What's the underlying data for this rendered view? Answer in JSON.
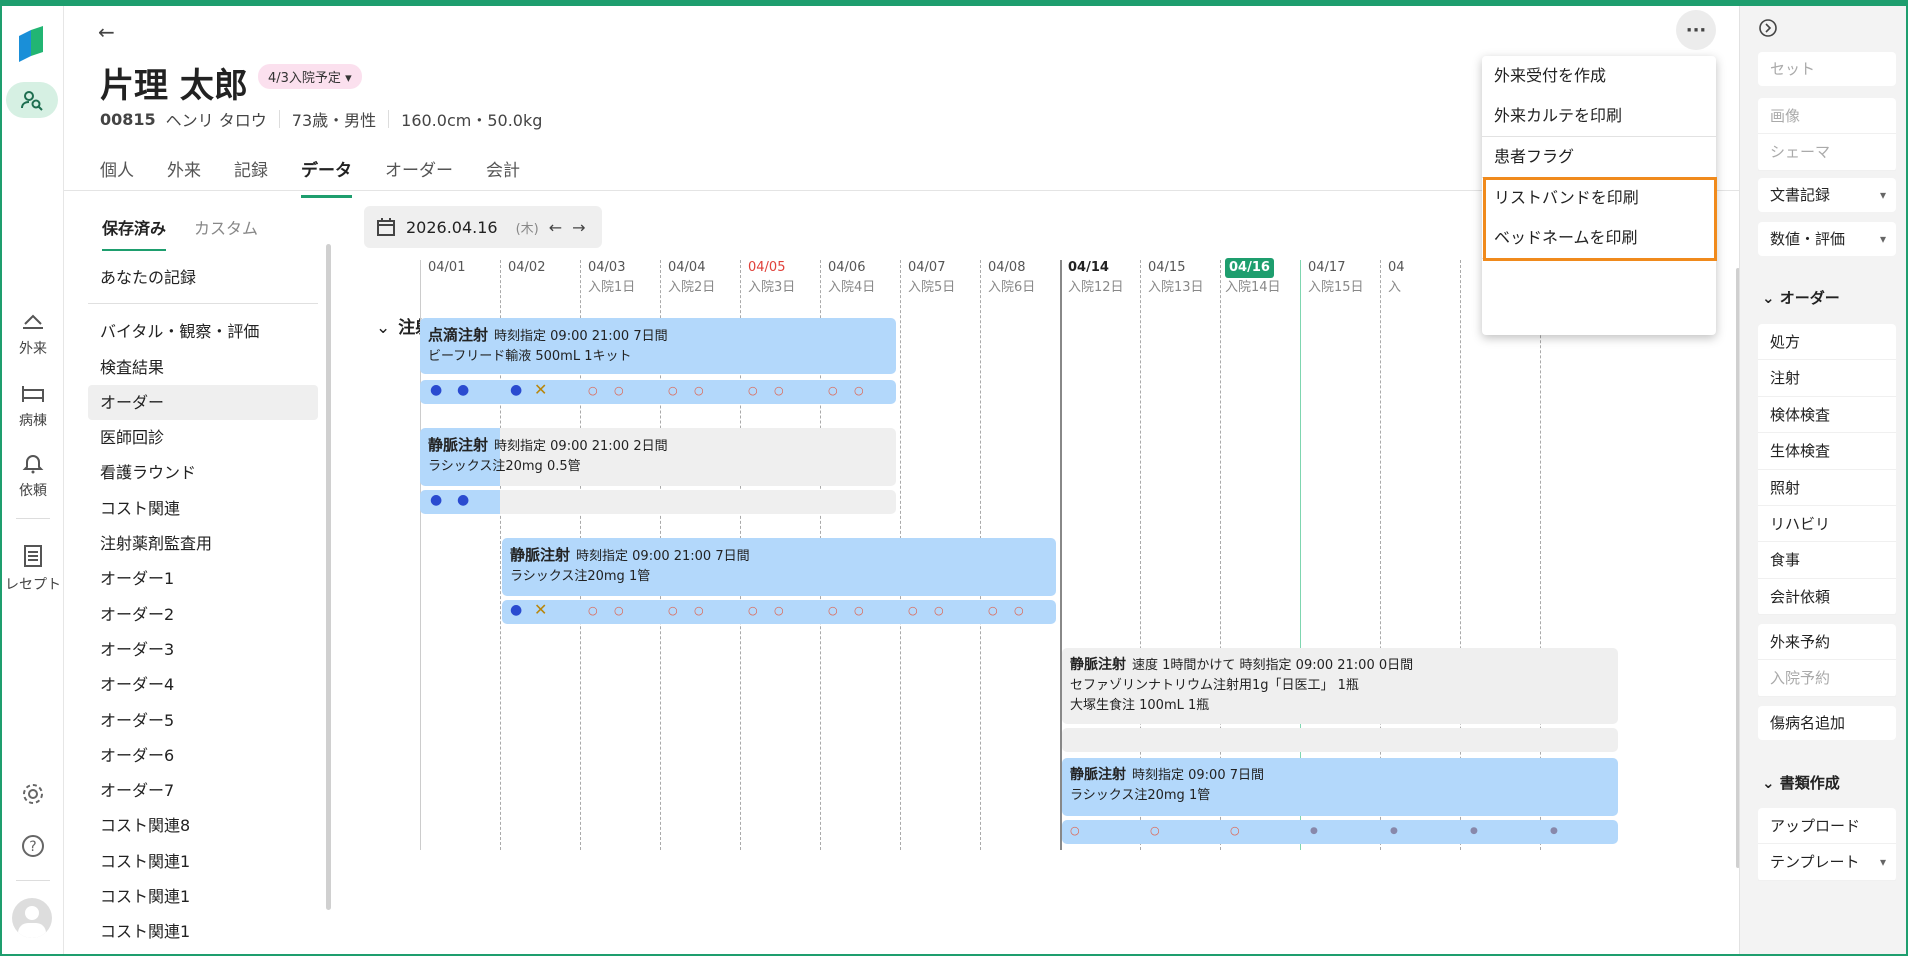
{
  "rail": {
    "items": [
      {
        "label": "外来",
        "icon": "reception-icon"
      },
      {
        "label": "病棟",
        "icon": "bed-icon"
      },
      {
        "label": "依頼",
        "icon": "bell-icon"
      },
      {
        "label": "レセプト",
        "icon": "receipt-icon"
      }
    ]
  },
  "patient": {
    "name": "片理 太郎",
    "admission_badge": "4/3入院予定",
    "id": "00815",
    "kana": "ヘンリ タロウ",
    "age_sex": "73歳・男性",
    "body": "160.0cm・50.0kg"
  },
  "tabs": [
    "個人",
    "外来",
    "記録",
    "データ",
    "オーダー",
    "会計"
  ],
  "active_tab": "データ",
  "subtabs": {
    "saved": "保存済み",
    "custom": "カスタム"
  },
  "left_list": {
    "first": "あなたの記録",
    "items": [
      "バイタル・観察・評価",
      "検査結果",
      "オーダー",
      "医師回診",
      "看護ラウンド",
      "コスト関連",
      "注射薬剤監査用",
      "オーダー1",
      "オーダー2",
      "オーダー3",
      "オーダー4",
      "オーダー5",
      "オーダー6",
      "オーダー7",
      "コスト関連8",
      "コスト関連1",
      "コスト関連1",
      "コスト関連1"
    ],
    "selected": "オーダー"
  },
  "date_nav": {
    "date": "2026.04.16",
    "weekday": "(木)"
  },
  "section": "注射",
  "timeline": {
    "days": [
      {
        "d": "04/01",
        "s": ""
      },
      {
        "d": "04/02",
        "s": ""
      },
      {
        "d": "04/03",
        "s": "入院1日"
      },
      {
        "d": "04/04",
        "s": "入院2日"
      },
      {
        "d": "04/05",
        "s": "入院3日"
      },
      {
        "d": "04/06",
        "s": "入院4日"
      },
      {
        "d": "04/07",
        "s": "入院5日"
      },
      {
        "d": "04/08",
        "s": "入院6日"
      },
      {
        "d": "04/14",
        "s": "入院12日"
      },
      {
        "d": "04/15",
        "s": "入院13日"
      },
      {
        "d": "04/16",
        "s": "入院14日"
      },
      {
        "d": "04/17",
        "s": "入院15日"
      },
      {
        "d": "04",
        "s": "入"
      }
    ],
    "orders": [
      {
        "title": "点滴注射",
        "spec": "時刻指定 09:00 21:00 7日間",
        "drug": "ビーフリード輸液 500mL 1キット"
      },
      {
        "title": "静脈注射",
        "spec": "時刻指定 09:00 21:00 2日間",
        "drug": "ラシックス注20mg 0.5管"
      },
      {
        "title": "静脈注射",
        "spec": "時刻指定 09:00 21:00 7日間",
        "drug": "ラシックス注20mg 1管"
      },
      {
        "title": "静脈注射",
        "spec": "速度 1時間かけて 時刻指定 09:00 21:00 0日間",
        "drug": "セファゾリンナトリウム注射用1g「日医工」 1瓶",
        "drug2": "大塚生食注 100mL 1瓶"
      },
      {
        "title": "静脈注射",
        "spec": "時刻指定 09:00 7日間",
        "drug": "ラシックス注20mg 1管"
      }
    ],
    "marks": {
      "dot": "●",
      "cross": "✕",
      "circle": "○",
      "small": "●"
    }
  },
  "menu": {
    "items": [
      "外来受付を作成",
      "外来カルテを印刷",
      "患者フラグ",
      "リストバンドを印刷",
      "ベッドネームを印刷"
    ]
  },
  "right_panel": {
    "set": "セット",
    "image": "画像",
    "schema": "シェーマ",
    "doc_record": "文書記録",
    "value_eval": "数値・評価",
    "order_head": "オーダー",
    "orders": [
      "処方",
      "注射",
      "検体検査",
      "生体検査",
      "照射",
      "リハビリ",
      "食事",
      "会計依頼"
    ],
    "outpatient_resv": "外来予約",
    "admission_resv": "入院予約",
    "disease_add": "傷病名追加",
    "doc_head": "書類作成",
    "upload": "アップロード",
    "template": "テンプレート"
  },
  "colors": {
    "accent": "#1e9e6e",
    "bar_blue": "#b3d8fb",
    "highlight": "#f08a1c",
    "today": "#1e9e6e"
  }
}
